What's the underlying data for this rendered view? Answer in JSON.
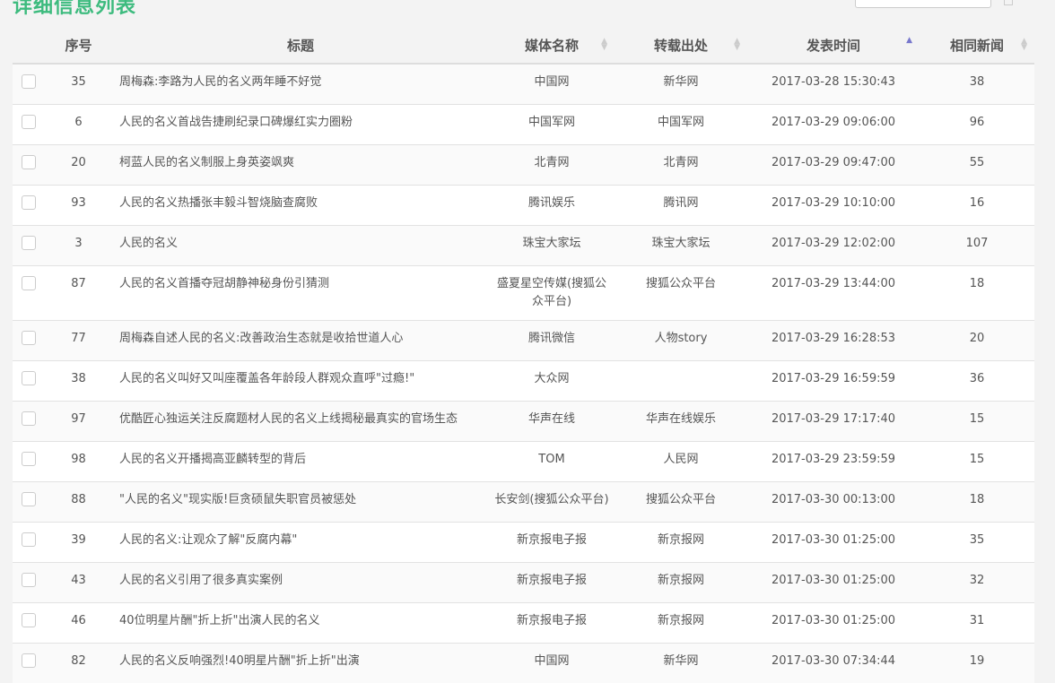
{
  "page_title": "详细信息列表",
  "columns": [
    "序号",
    "标题",
    "媒体名称",
    "转载出处",
    "发表时间",
    "相同新闻"
  ],
  "rows": [
    [
      "35",
      "周梅森:李路为人民的名义两年睡不好觉",
      "中国网",
      "新华网",
      "2017-03-28 15:30:43",
      "38"
    ],
    [
      "6",
      "人民的名义首战告捷刷纪录口碑爆红实力圈粉",
      "中国军网",
      "中国军网",
      "2017-03-29 09:06:00",
      "96"
    ],
    [
      "20",
      "柯蓝人民的名义制服上身英姿飒爽",
      "北青网",
      "北青网",
      "2017-03-29 09:47:00",
      "55"
    ],
    [
      "93",
      "人民的名义热播张丰毅斗智烧脑查腐败",
      "腾讯娱乐",
      "腾讯网",
      "2017-03-29 10:10:00",
      "16"
    ],
    [
      "3",
      "人民的名义",
      "珠宝大家坛",
      "珠宝大家坛",
      "2017-03-29 12:02:00",
      "107"
    ],
    [
      "87",
      "人民的名义首播夺冠胡静神秘身份引猜测",
      "盛夏星空传媒(搜狐公众平台)",
      "搜狐公众平台",
      "2017-03-29 13:44:00",
      "18"
    ],
    [
      "77",
      "周梅森自述人民的名义:改善政治生态就是收拾世道人心",
      "腾讯微信",
      "人物story",
      "2017-03-29 16:28:53",
      "20"
    ],
    [
      "38",
      "人民的名义叫好又叫座覆盖各年龄段人群观众直呼\"过瘾!\"",
      "大众网",
      "",
      "2017-03-29 16:59:59",
      "36"
    ],
    [
      "97",
      "优酷匠心独运关注反腐题材人民的名义上线揭秘最真实的官场生态",
      "华声在线",
      "华声在线娱乐",
      "2017-03-29 17:17:40",
      "15"
    ],
    [
      "98",
      "人民的名义开播揭高亚麟转型的背后",
      "TOM",
      "人民网",
      "2017-03-29 23:59:59",
      "15"
    ],
    [
      "88",
      "\"人民的名义\"现实版!巨贪硕鼠失职官员被惩处",
      "长安剑(搜狐公众平台)",
      "搜狐公众平台",
      "2017-03-30 00:13:00",
      "18"
    ],
    [
      "39",
      "人民的名义:让观众了解\"反腐内幕\"",
      "新京报电子报",
      "新京报网",
      "2017-03-30 01:25:00",
      "35"
    ],
    [
      "43",
      "人民的名义引用了很多真实案例",
      "新京报电子报",
      "新京报网",
      "2017-03-30 01:25:00",
      "32"
    ],
    [
      "46",
      "40位明星片酬\"折上折\"出演人民的名义",
      "新京报电子报",
      "新京报网",
      "2017-03-30 01:25:00",
      "31"
    ],
    [
      "82",
      "人民的名义反响强烈!40明星片酬\"折上折\"出演",
      "中国网",
      "新华网",
      "2017-03-30 07:34:44",
      "19"
    ]
  ]
}
